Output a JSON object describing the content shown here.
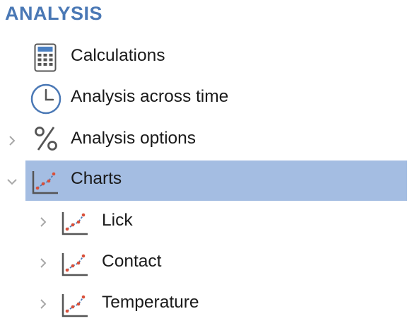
{
  "section": {
    "title": "ANALYSIS"
  },
  "tree": {
    "calculations": {
      "label": "Calculations",
      "icon": "calculator-icon"
    },
    "time": {
      "label": "Analysis across time",
      "icon": "clock-icon"
    },
    "options": {
      "label": "Analysis options",
      "icon": "percent-icon",
      "expanded": false
    },
    "charts": {
      "label": "Charts",
      "icon": "chart-icon",
      "expanded": true,
      "selected": true,
      "children": [
        {
          "label": "Lick",
          "icon": "chart-icon",
          "expanded": false
        },
        {
          "label": "Contact",
          "icon": "chart-icon",
          "expanded": false
        },
        {
          "label": "Temperature",
          "icon": "chart-icon",
          "expanded": false
        }
      ]
    }
  },
  "colors": {
    "accent": "#4a78b5",
    "selection": "#a4bde2"
  }
}
